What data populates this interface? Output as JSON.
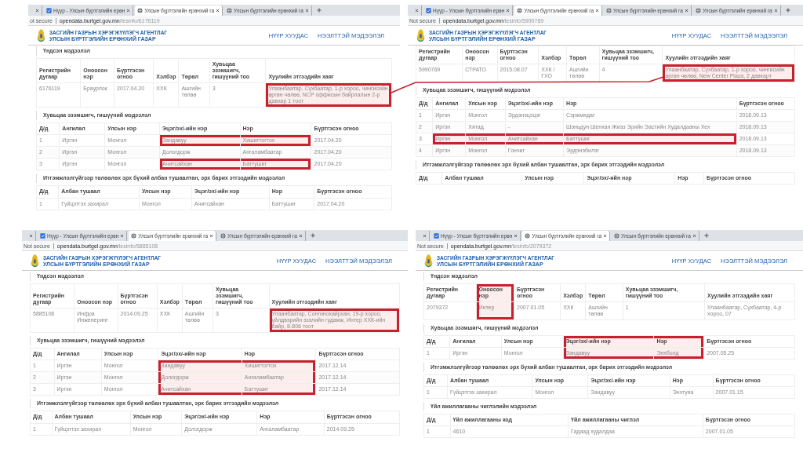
{
  "panels": [
    {
      "tabs": [
        {
          "selected": false
        },
        {
          "title": "Нүүр - Улсын бүртгэлийн ерөн",
          "selected": false
        },
        {
          "title": "Улсын бүртгэлийн ерөнхий га",
          "selected": true
        },
        {
          "title": "Улсын бүртгэлийн ерөнхий га",
          "selected": false
        }
      ],
      "address": {
        "security": "ot secure",
        "host": "opendata.burtgel.gov.mn",
        "path": "/lesinfo/6176119"
      },
      "header": {
        "agency": "ЗАСГИЙН ГАЗРЫН ХЭРЭГЖҮҮЛЭГЧ АГЕНТЛАГ",
        "org": "УЛСЫН БҮРТГЭЛИЙН ЕРӨНХИЙ ГАЗАР",
        "nav": [
          "НҮҮР ХУУДАС",
          "НЭЭЛТТЭЙ МЭДЭЭЛЭЛ"
        ]
      },
      "sections": [
        {
          "title": "Үндсэн мэдээлэл",
          "table": {
            "columns": [
              "Регистрийн дугаар",
              "Оноосон нэр",
              "Бүртгэсэн огноо",
              "Хэлбэр",
              "Төрөл",
              "Хувьцаа эзэмшигч, гишүүний тоо",
              "Хуулийн этгээдийн хаяг"
            ],
            "columns_boxed": [
              false,
              false,
              false,
              false,
              false,
              false,
              false
            ],
            "rows": [
              {
                "cells": [
                  "6176119",
                  "Браурлок",
                  "2017.04.20",
                  "ХХК",
                  "Ашгийн төлөө",
                  "3",
                  "Улаанбаатар, Сүхбаатар, 1-р хороо, чингисийн өргөн чөлөө, NCP оффисын байрлалын 2-р давхар 1 тоот"
                ],
                "boxed": [
                  false,
                  false,
                  false,
                  false,
                  false,
                  false,
                  true
                ]
              }
            ]
          }
        },
        {
          "title": "Хувьцаа эзэмшигч, гишүүний мэдээлэл",
          "table": {
            "columns": [
              "Д/д",
              "Ангилал",
              "Улсын нэр",
              "Эцэг/эх/-ийн нэр",
              "Нэр",
              "Бүртгэсэн огноо"
            ],
            "columns_boxed": [
              false,
              false,
              false,
              false,
              false,
              false
            ],
            "rows": [
              {
                "cells": [
                  "1",
                  "Иргэн",
                  "Монгол",
                  "Зандавуу",
                  "Хишигтогтох",
                  "2017.04.20"
                ],
                "boxed": [
                  false,
                  false,
                  false,
                  true,
                  true,
                  false
                ]
              },
              {
                "cells": [
                  "2",
                  "Иргэн",
                  "Монгол",
                  "Дологдорж",
                  "Ангаламбаатар",
                  "2017.04.20"
                ],
                "boxed": [
                  false,
                  false,
                  false,
                  false,
                  false,
                  false
                ]
              },
              {
                "cells": [
                  "3",
                  "Иргэн",
                  "Монгол",
                  "Ачитсайхан",
                  "Баттушиг",
                  "2017.04.20"
                ],
                "boxed": [
                  false,
                  false,
                  false,
                  true,
                  true,
                  false
                ]
              }
            ]
          }
        },
        {
          "title": "Итгэмжлэлгүйгээр төлөөлөх эрх бүхий албан тушаалтан, эрх барих этгээдийн мэдээлэл",
          "table": {
            "columns": [
              "Д/д",
              "Албан тушаал",
              "Улсын нэр",
              "Эцэг/эх/-ийн нэр",
              "Нэр",
              "Бүртгэсэн огноо"
            ],
            "columns_boxed": [
              false,
              false,
              false,
              false,
              false,
              false
            ],
            "rows": [
              {
                "cells": [
                  "1",
                  "Гүйцэтгэх захирал",
                  "Монгол",
                  "Ачитсайхан",
                  "Баттушиг",
                  "2017.04.20"
                ],
                "boxed": [
                  false,
                  false,
                  false,
                  false,
                  false,
                  false
                ]
              }
            ]
          }
        }
      ]
    },
    {
      "tabs": [
        {
          "selected": false
        },
        {
          "title": "Нүүр - Улсын бүртгэлийн ерөн",
          "selected": false
        },
        {
          "title": "Улсын бүртгэлийн ерөнхий га",
          "selected": true
        },
        {
          "title": "Улсын бүртгэлийн ерөнхий га",
          "selected": false
        },
        {
          "title": "Улсын бүртгэлийн ерөнхий га",
          "selected": false
        }
      ],
      "address": {
        "security": "Not secure",
        "host": "opendata.burtgel.gov.mn",
        "path": "/lesinfo/5990769"
      },
      "header": {
        "agency": "ЗАСГИЙН ГАЗРЫН ХЭРЭГЖҮҮЛЭГЧ АГЕНТЛАГ",
        "org": "УЛСЫН БҮРТГЭЛИЙН ЕРӨНХИЙ ГАЗАР",
        "nav": [
          "НҮҮР ХУУДАС",
          "НЭЭЛТТЭЙ МЭДЭЭЛЭЛ"
        ]
      },
      "sections": [
        {
          "table": {
            "columns": [
              "Регистрийн дугаар",
              "Оноосон нэр",
              "Бүртгэсэн огноо",
              "Хэлбэр",
              "Төрөл",
              "Хувьцаа эзэмшигч, гишүүний тоо",
              "Хуулийн этгээдийн хаяг"
            ],
            "columns_boxed": [
              false,
              false,
              false,
              false,
              false,
              false,
              false
            ],
            "rows": [
              {
                "cells": [
                  "5990769",
                  "СТРАТО",
                  "2015.08.07",
                  "ХХК / ГХО",
                  "Ашгийн төлөө",
                  "4",
                  "Улаанбаатар, Сүхбаатар, 1-р хороо, чингисийн өргөн чөлөө, New Center Plaza, 2 давхарт"
                ],
                "boxed": [
                  false,
                  false,
                  false,
                  false,
                  false,
                  false,
                  true
                ]
              }
            ]
          }
        },
        {
          "title": "Хувьцаа эзэмшигч, гишүүний мэдээлэл",
          "table": {
            "columns": [
              "Д/д",
              "Ангилал",
              "Улсын нэр",
              "Эцэг/эх/-ийн нэр",
              "Нэр",
              "Бүртгэсэн огноо"
            ],
            "columns_boxed": [
              false,
              false,
              false,
              false,
              false,
              false
            ],
            "rows": [
              {
                "cells": [
                  "1",
                  "Иргэн",
                  "Монгол",
                  "Эрдэнэцэцэг",
                  "Сэржмядаг",
                  "2018.09.13"
                ],
                "boxed": [
                  false,
                  false,
                  false,
                  false,
                  false,
                  false
                ]
              },
              {
                "cells": [
                  "2",
                  "Иргэн",
                  "Хятад",
                  "-",
                  "Шэньдун Шенхан Жиэз Эрийн Эастийн Худалдааны Хех",
                  "2018.09.13"
                ],
                "boxed": [
                  false,
                  false,
                  false,
                  false,
                  false,
                  false
                ]
              },
              {
                "cells": [
                  "3",
                  "Иргэн",
                  "Монгол",
                  "Ачитсайхан",
                  "Баттушиг",
                  "2018.09.13"
                ],
                "boxed": [
                  false,
                  true,
                  true,
                  true,
                  true,
                  false
                ]
              },
              {
                "cells": [
                  "4",
                  "Иргэн",
                  "Монгол",
                  "Гончиг",
                  "Эрдэнэбилэг",
                  "2018.09.13"
                ],
                "boxed": [
                  false,
                  false,
                  false,
                  false,
                  false,
                  false
                ]
              }
            ]
          }
        },
        {
          "title": "Итгэмжлэлгүйгээр төлөөлөх эрх бүхий албан тушаалтан, эрх барих этгээдийн мэдээлэл",
          "table": {
            "columns": [
              "Д/д",
              "Албан тушаал",
              "Улсын нэр",
              "Эцэг/эх/-ийн нэр",
              "Нэр",
              "Бүртгэсэн огноо"
            ],
            "columns_boxed": [
              false,
              false,
              false,
              false,
              false,
              false
            ]
          }
        }
      ]
    },
    {
      "tabs": [
        {
          "selected": false
        },
        {
          "title": "Нүүр - Улсын бүртгэлийн ерөн",
          "selected": false
        },
        {
          "title": "Улсын бүртгэлийн ерөнхий га",
          "selected": true
        },
        {
          "title": "Улсын бүртгэлийн ерөнхий га",
          "selected": false
        }
      ],
      "address": {
        "security": "Not secure",
        "host": "opendata.burtgel.gov.mn",
        "path": "/lesinfo/5885108"
      },
      "header": {
        "agency": "ЗАСГИЙН ГАЗРЫН ХЭРЭГЖҮҮЛЭГЧ АГЕНТЛАГ",
        "org": "УЛСЫН БҮРТГЭЛИЙН ЕРӨНХИЙ ГАЗАР",
        "nav": [
          "НҮҮР ХУУДАС",
          "НЭЭЛТТЭЙ МЭДЭЭЛЭЛ"
        ]
      },
      "sections": [
        {
          "title": "Үндсэн мэдээлэл",
          "table": {
            "columns": [
              "Регистрийн дугаар",
              "Оноосон нэр",
              "Бүртгэсэн огноо",
              "Хэлбэр",
              "Төрөл",
              "Хувьцаа эзэмшигч, гишүүний тоо",
              "Хуулийн этгээдийн хаяг"
            ],
            "columns_boxed": [
              false,
              false,
              false,
              false,
              false,
              false,
              false
            ],
            "rows": [
              {
                "cells": [
                  "5885108",
                  "Инфра Инженеринг",
                  "2014.09.25",
                  "ХХК",
                  "Ашгийн төлөө",
                  "3",
                  "Улаанбаатар, Сонгинохайрхан, 19-р хороо, үйлдвэрийн эзэлийн гудамж, Интер ХХК-ийн байр, 8-806 тоот"
                ],
                "boxed": [
                  false,
                  false,
                  false,
                  false,
                  false,
                  false,
                  true
                ]
              }
            ]
          }
        },
        {
          "title": "Хувьцаа эзэмшигч, гишүүний мэдээлэл",
          "table": {
            "columns": [
              "Д/д",
              "Ангилал",
              "Улсын нэр",
              "Эцэг/эх/-ийн нэр",
              "Нэр",
              "Бүртгэсэн огноо"
            ],
            "columns_boxed": [
              false,
              false,
              false,
              false,
              false,
              false
            ],
            "rows": [
              {
                "cells": [
                  "1",
                  "Иргэн",
                  "Монгол",
                  "Зандавуу",
                  "Хишигтогтох",
                  "2017.12.14"
                ],
                "boxed": [
                  false,
                  false,
                  false,
                  true,
                  true,
                  false
                ]
              },
              {
                "cells": [
                  "2",
                  "Иргэн",
                  "Монгол",
                  "Дологдорж",
                  "Ангаламбаатар",
                  "2017.12.14"
                ],
                "boxed": [
                  false,
                  false,
                  false,
                  true,
                  true,
                  false
                ]
              },
              {
                "cells": [
                  "3",
                  "Иргэн",
                  "Монгол",
                  "Ачитсайхан",
                  "Баттушиг",
                  "2017.12.14"
                ],
                "boxed": [
                  false,
                  false,
                  false,
                  true,
                  true,
                  false
                ]
              }
            ]
          }
        },
        {
          "title": "Итгэмжлэлгүйгээр төлөөлөх эрх бүхий албан тушаалтан, эрх барих этгээдийн мэдээлэл",
          "table": {
            "columns": [
              "Д/д",
              "Албан тушаал",
              "Улсын нэр",
              "Эцэг/эх/-ийн нэр",
              "Нэр",
              "Бүртгэсэн огноо"
            ],
            "columns_boxed": [
              false,
              false,
              false,
              false,
              false,
              false
            ],
            "rows": [
              {
                "cells": [
                  "1",
                  "Гүйцэтгэх захирал",
                  "Монгол",
                  "Дологдорж",
                  "Ангаламбаатар",
                  "2014.09.25"
                ],
                "boxed": [
                  false,
                  false,
                  false,
                  false,
                  false,
                  false
                ]
              }
            ]
          }
        }
      ]
    },
    {
      "tabs": [
        {
          "selected": false
        },
        {
          "title": "Нүүр - Улсын бүртгэлийн ерөн",
          "selected": false
        },
        {
          "title": "Улсын бүртгэлийн ерөнхий га",
          "selected": true
        },
        {
          "title": "Улсын бүртгэлийн ерөнхий га",
          "selected": false
        }
      ],
      "address": {
        "security": "Not secure",
        "host": "opendata.burtgel.gov.mn",
        "path": "/lesinfo/2079372"
      },
      "header": {
        "agency": "ЗАСГИЙН ГАЗРЫН ХЭРЭГЖҮҮЛЭГЧ АГЕНТЛАГ",
        "org": "УЛСЫН БҮРТГЭЛИЙН ЕРӨНХИЙ ГАЗАР",
        "nav": [
          "НҮҮР ХУУДАС",
          "НЭЭЛТТЭЙ МЭДЭЭЛЭЛ"
        ]
      },
      "sections": [
        {
          "title": "Үндсэн мэдээлэл",
          "table": {
            "columns": [
              "Регистрийн дугаар",
              "Оноосон нэр",
              "Бүртгэсэн огноо",
              "Хэлбэр",
              "Төрөл",
              "Хувьцаа эзэмшигч, гишүүний тоо",
              "Хуулийн этгээдийн хаяг"
            ],
            "columns_boxed": [
              false,
              true,
              false,
              false,
              false,
              false,
              false
            ],
            "rows": [
              {
                "cells": [
                  "2079372",
                  "Интер",
                  "2007.01.05",
                  "ХХК",
                  "Ашгийн төлөө",
                  "1",
                  "Улаанбаатар, Сүхбаатар, 4-р хороо, 07"
                ],
                "boxed": [
                  false,
                  true,
                  false,
                  false,
                  false,
                  false,
                  false
                ]
              }
            ]
          }
        },
        {
          "title": "Хувьцаа эзэмшигч, гишүүний мэдээлэл",
          "table": {
            "columns": [
              "Д/д",
              "Ангилал",
              "Улсын нэр",
              "Эцэг/эх/-ийн нэр",
              "Нэр",
              "Бүртгэсэн огноо"
            ],
            "columns_boxed": [
              false,
              false,
              false,
              true,
              true,
              false
            ],
            "rows": [
              {
                "cells": [
                  "1",
                  "Иргэн",
                  "Монгол",
                  "Зандавуу",
                  "Энхболд",
                  "2007.05.25"
                ],
                "boxed": [
                  false,
                  false,
                  false,
                  true,
                  true,
                  false
                ]
              }
            ]
          }
        },
        {
          "title": "Итгэмжлэлгүйгээр төлөөлөх эрх бүхий албан тушаалтан, эрх барих этгээдийн мэдээлэл",
          "table": {
            "columns": [
              "Д/д",
              "Албан тушаал",
              "Улсын нэр",
              "Эцэг/эх/-ийн нэр",
              "Нэр",
              "Бүртгэсэн огноо"
            ],
            "columns_boxed": [
              false,
              false,
              false,
              false,
              false,
              false
            ],
            "rows": [
              {
                "cells": [
                  "1",
                  "Гүйцэтгэх захирал",
                  "Монгол",
                  "Зандавуу",
                  "Энхтуяа",
                  "2007.01.15"
                ],
                "boxed": [
                  false,
                  false,
                  false,
                  false,
                  false,
                  false
                ]
              }
            ]
          }
        },
        {
          "title": "Үйл ажиллагааны чиглэлийн мэдээлэл",
          "table": {
            "columns": [
              "Д/д",
              "Үйл ажиллагааны код",
              "Үйл ажиллагааны чиглэл",
              "Бүртгэсэн огноо"
            ],
            "columns_boxed": [
              false,
              false,
              false,
              false
            ],
            "rows": [
              {
                "cells": [
                  "1",
                  "4610",
                  "Гадаад худалдаа",
                  "2007.01.05"
                ],
                "boxed": [
                  false,
                  false,
                  false,
                  false
                ]
              }
            ]
          }
        }
      ]
    }
  ]
}
